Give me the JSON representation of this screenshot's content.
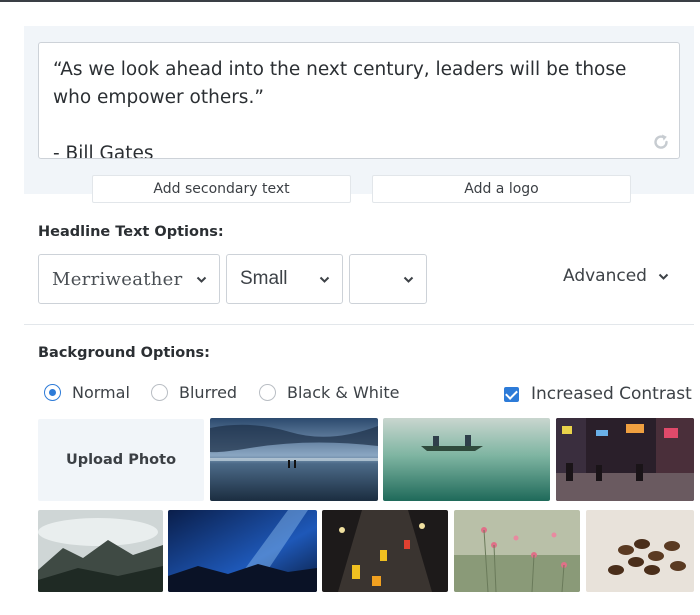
{
  "quote": {
    "text": "“As we look ahead into the next century, leaders will be those who empower others.”",
    "author": "- Bill Gates"
  },
  "buttons": {
    "secondary_text": "Add secondary text",
    "logo": "Add a logo"
  },
  "headline": {
    "title": "Headline Text Options:",
    "font": "Merriweather",
    "size": "Small",
    "color": "",
    "advanced": "Advanced"
  },
  "background": {
    "title": "Background Options:",
    "options": [
      "Normal",
      "Blurred",
      "Black & White"
    ],
    "selected": "Normal",
    "increased_contrast": {
      "label": "Increased Contrast",
      "checked": true
    },
    "upload_label": "Upload Photo",
    "photos": [
      "beach-dusk",
      "canoe-lake",
      "city-night-street",
      "misty-mountains",
      "night-sky",
      "traffic-lights",
      "pink-flowers",
      "coffee-beans"
    ]
  },
  "colors": {
    "accent": "#2d7bd8",
    "panel": "#f1f5f9",
    "border": "#cdd2d8"
  }
}
